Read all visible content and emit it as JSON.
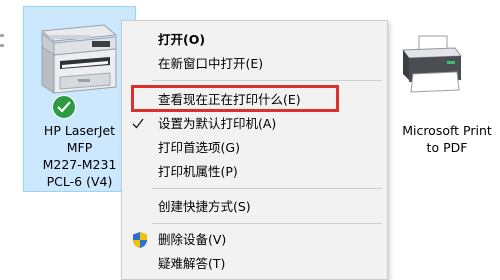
{
  "devices": [
    {
      "id": "hp",
      "label": "HP LaserJet\nMFP\nM227-M231\nPCL-6 (V4)",
      "selected": true,
      "default": true
    },
    {
      "id": "ms",
      "label": "Microsoft Print\nto PDF",
      "selected": false,
      "default": false
    }
  ],
  "context_menu": {
    "items": [
      {
        "label": "打开(O)",
        "bold": true
      },
      {
        "label": "在新窗口中打开(E)"
      },
      {
        "label": "查看现在正在打印什么(E)",
        "highlighted": true
      },
      {
        "label": "设置为默认打印机(A)",
        "checked": true
      },
      {
        "label": "打印首选项(G)"
      },
      {
        "label": "打印机属性(P)"
      },
      {
        "label": "创建快捷方式(S)"
      },
      {
        "label": "删除设备(V)",
        "icon": "shield-icon"
      },
      {
        "label": "疑难解答(T)"
      }
    ]
  },
  "colors": {
    "selection_bg": "#cce8ff",
    "selection_border": "#99d1ff",
    "highlight_border": "#d9312b",
    "default_badge": "#2c9b43",
    "menu_bg": "#f2f2f2"
  }
}
